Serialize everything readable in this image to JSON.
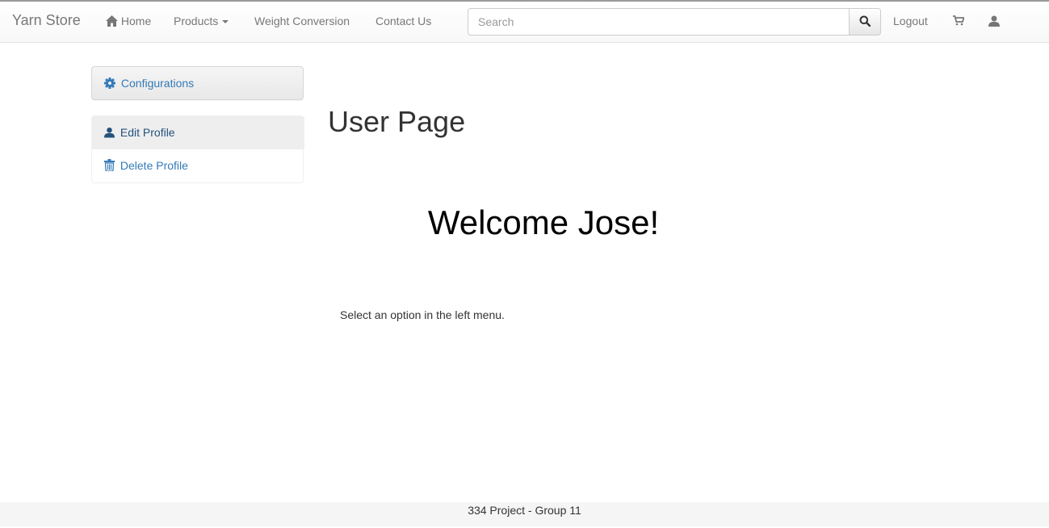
{
  "navbar": {
    "brand": "Yarn Store",
    "links": {
      "home": "Home",
      "products": "Products",
      "weight_conversion": "Weight Conversion",
      "contact": "Contact Us",
      "logout": "Logout"
    },
    "search": {
      "placeholder": "Search",
      "value": ""
    },
    "icons": [
      "home-icon",
      "search-icon",
      "cart-icon",
      "user-icon"
    ]
  },
  "sidebar": {
    "heading": "Configurations",
    "heading_icon": "gear-icon",
    "items": [
      {
        "label": "Edit Profile",
        "icon": "user-icon",
        "active": true
      },
      {
        "label": "Delete Profile",
        "icon": "trash-icon",
        "active": false
      }
    ]
  },
  "main": {
    "title": "User Page",
    "welcome": "Welcome Jose!",
    "hint": "Select an option in the left menu."
  },
  "footer": {
    "text": "334 Project - Group 11"
  },
  "colors": {
    "link": "#337ab7",
    "nav_text": "#777777",
    "active_bg": "#eeeeee",
    "footer_bg": "#f5f5f5"
  }
}
